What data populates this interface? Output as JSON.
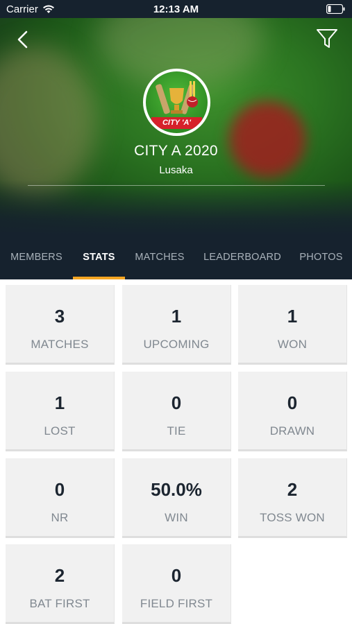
{
  "status_bar": {
    "carrier": "Carrier",
    "time": "12:13 AM"
  },
  "header": {
    "team_name": "CITY A 2020",
    "city": "Lusaka",
    "logo_text": "CITY 'A'"
  },
  "tabs": [
    {
      "label": "MEMBERS",
      "active": false
    },
    {
      "label": "STATS",
      "active": true
    },
    {
      "label": "MATCHES",
      "active": false
    },
    {
      "label": "LEADERBOARD",
      "active": false
    },
    {
      "label": "PHOTOS",
      "active": false
    }
  ],
  "stats": [
    {
      "value": "3",
      "label": "MATCHES"
    },
    {
      "value": "1",
      "label": "UPCOMING"
    },
    {
      "value": "1",
      "label": "WON"
    },
    {
      "value": "1",
      "label": "LOST"
    },
    {
      "value": "0",
      "label": "TIE"
    },
    {
      "value": "0",
      "label": "DRAWN"
    },
    {
      "value": "0",
      "label": "NR"
    },
    {
      "value": "50.0%",
      "label": "WIN"
    },
    {
      "value": "2",
      "label": "TOSS WON"
    },
    {
      "value": "2",
      "label": "BAT FIRST"
    },
    {
      "value": "0",
      "label": "FIELD FIRST"
    }
  ],
  "colors": {
    "tab_bar_bg": "#16222e",
    "active_indicator": "#f5a623",
    "card_bg": "#f1f1f1",
    "value_text": "#1c2530",
    "label_text": "#808890"
  }
}
